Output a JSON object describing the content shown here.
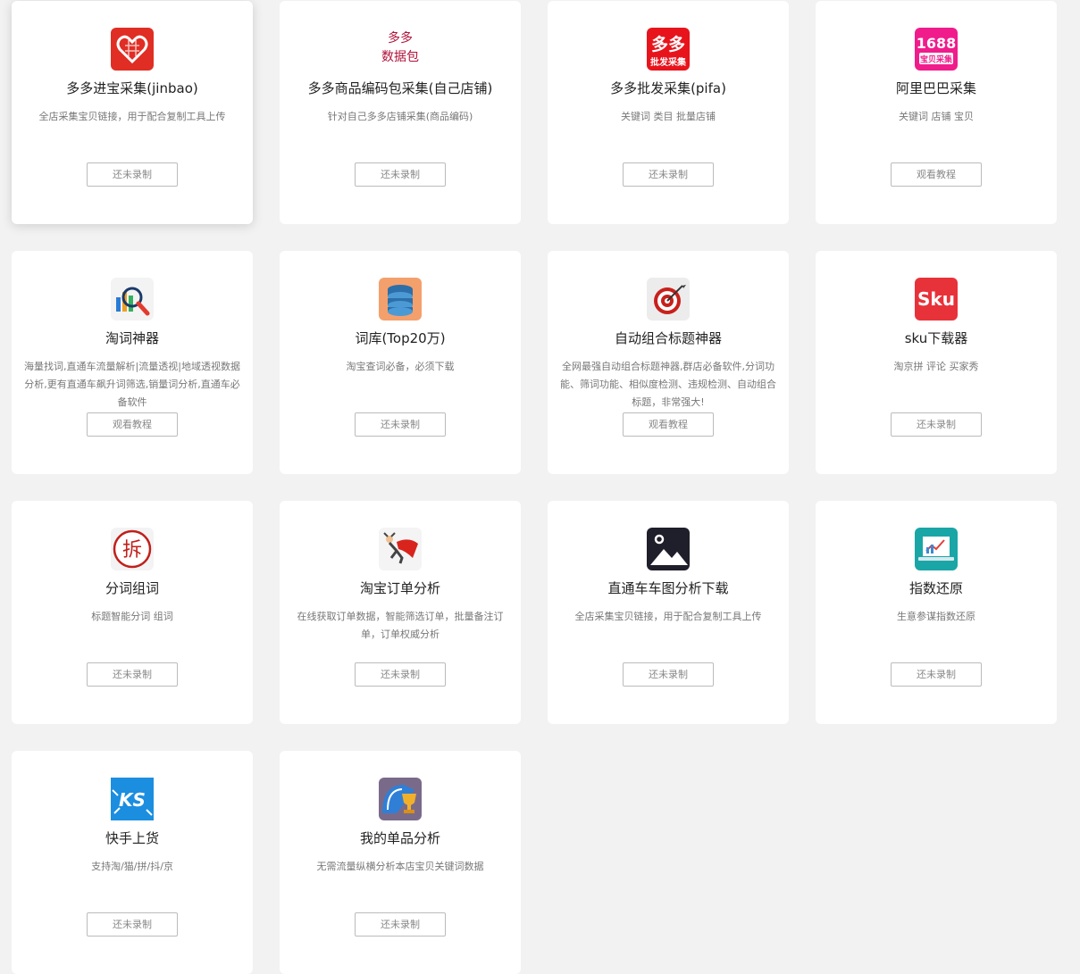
{
  "cards": [
    {
      "title": "多多进宝采集(jinbao)",
      "desc": "全店采集宝贝链接，用于配合复制工具上传",
      "button": "还未录制",
      "icon": "pdd-jinbao-icon"
    },
    {
      "title": "多多商品编码包采集(自己店铺)",
      "desc": "针对自己多多店铺采集(商品编码)",
      "button": "还未录制",
      "icon": "duoduo-datapack-icon",
      "icon_text": [
        "多多",
        "数据包"
      ]
    },
    {
      "title": "多多批发采集(pifa)",
      "desc": "关键词 类目 批量店铺",
      "button": "还未录制",
      "icon": "pifa-icon",
      "icon_text": [
        "多多",
        "批发采集"
      ]
    },
    {
      "title": "阿里巴巴采集",
      "desc": "关键词 店铺 宝贝",
      "button": "观看教程",
      "icon": "ali-1688-icon",
      "icon_text": [
        "1688",
        "宝贝采集"
      ]
    },
    {
      "title": "淘词神器",
      "desc": "海量找词,直通车流量解析|流量透视|地域透视数据分析,更有直通车飙升词筛选,销量词分析,直通车必备软件",
      "button": "观看教程",
      "icon": "magnifier-chart-icon"
    },
    {
      "title": "词库(Top20万)",
      "desc": "淘宝查词必备，必须下载",
      "button": "还未录制",
      "icon": "database-icon"
    },
    {
      "title": "自动组合标题神器",
      "desc": "全网最强自动组合标题神器,群店必备软件,分词功能、筛词功能、相似度检测、违规检测、自动组合标题，非常强大!",
      "button": "观看教程",
      "icon": "target-icon"
    },
    {
      "title": "sku下载器",
      "desc": "淘京拼 评论 买家秀",
      "button": "还未录制",
      "icon": "sku-icon",
      "icon_text": [
        "Sku"
      ]
    },
    {
      "title": "分词组词",
      "desc": "标题智能分词 组词",
      "button": "还未录制",
      "icon": "split-word-icon",
      "icon_text": [
        "拆"
      ]
    },
    {
      "title": "淘宝订单分析",
      "desc": "在线获取订单数据，智能筛选订单，批量备注订单，订单权威分析",
      "button": "还未录制",
      "icon": "superhero-icon"
    },
    {
      "title": "直通车车图分析下载",
      "desc": "全店采集宝贝链接，用于配合复制工具上传",
      "button": "还未录制",
      "icon": "image-icon"
    },
    {
      "title": "指数还原",
      "desc": "生意参谋指数还原",
      "button": "还未录制",
      "icon": "laptop-chart-icon"
    },
    {
      "title": "快手上货",
      "desc": "支持淘/猫/拼/抖/京",
      "button": "还未录制",
      "icon": "kuaishou-icon",
      "icon_text": [
        "KS"
      ]
    },
    {
      "title": "我的单品分析",
      "desc": "无需流量纵横分析本店宝贝关键词数据",
      "button": "还未录制",
      "icon": "trophy-icon"
    }
  ]
}
